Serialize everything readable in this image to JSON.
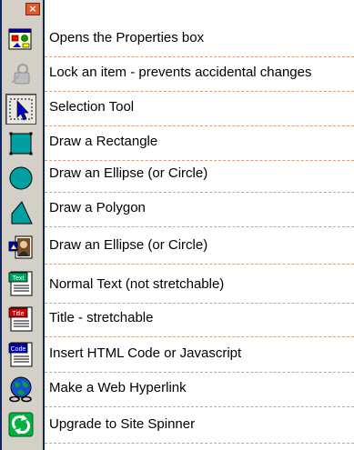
{
  "toolbar": {
    "close_glyph": "×",
    "tools": [
      {
        "icon": "properties-icon"
      },
      {
        "icon": "lock-icon"
      },
      {
        "icon": "selection-arrow-icon",
        "active": true
      },
      {
        "icon": "rectangle-icon"
      },
      {
        "icon": "ellipse-icon"
      },
      {
        "icon": "polygon-icon"
      },
      {
        "icon": "image-icon"
      },
      {
        "icon": "text-icon",
        "icon_text": "Text"
      },
      {
        "icon": "title-icon",
        "icon_text": "Title"
      },
      {
        "icon": "code-icon",
        "icon_text": "Code"
      },
      {
        "icon": "hyperlink-globe-icon"
      },
      {
        "icon": "site-spinner-icon"
      }
    ]
  },
  "descriptions": [
    "Opens the Properties box",
    "Lock an item - prevents accidental changes",
    "Selection Tool",
    "Draw a Rectangle",
    "Draw an Ellipse (or Circle)",
    "Draw a Polygon",
    "Draw an Ellipse (or Circle)",
    "Normal Text (not stretchable)",
    "Title - stretchable",
    "Insert HTML Code or Javascript",
    "Make a Web Hyperlink",
    "Upgrade to Site Spinner"
  ],
  "colors": {
    "toolbar_bg": "#d4d0c8",
    "toolbar_border": "#0a246a",
    "rule": "#d8a07a",
    "shape_fill": "#00a0a0"
  }
}
